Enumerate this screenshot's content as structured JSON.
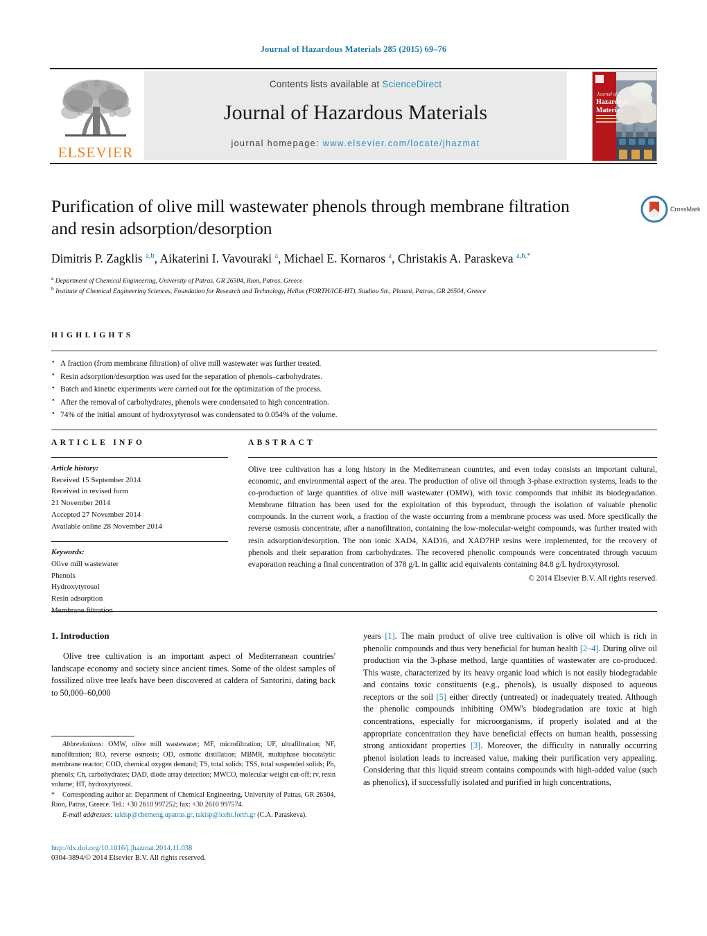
{
  "running_head": "Journal of Hazardous Materials 285 (2015) 69–76",
  "masthead": {
    "publisher_name": "ELSEVIER",
    "contents_prefix": "Contents lists available at",
    "contents_link": "ScienceDirect",
    "journal_title": "Journal of Hazardous Materials",
    "homepage_prefix": "journal homepage:",
    "homepage_url": "www.elsevier.com/locate/jhazmat",
    "cover_line1": "Journal of",
    "cover_line2": "Hazardous",
    "cover_line3": "Materials"
  },
  "article": {
    "title": "Purification of olive mill wastewater phenols through membrane filtration and resin adsorption/desorption",
    "authors_html": "Dimitris P. Zagklis <sup>a,b</sup>, Aikaterini I. Vavouraki <sup>a</sup>, Michael E. Kornaros <sup>a</sup>, Christakis A. Paraskeva <sup>a,b,</sup><sup>*</sup>",
    "affiliation_a": "Department of Chemical Engineering, University of Patras, GR 26504, Rion, Patras, Greece",
    "affiliation_b": "Institute of Chemical Engineering Sciences, Foundation for Research and Technology, Hellas (FORTH/ICE-HT), Stadiou Str., Platani, Patras, GR 26504, Greece",
    "crossmark_label": "CrossMark"
  },
  "highlights": {
    "heading": "HIGHLIGHTS",
    "items": [
      "A fraction (from membrane filtration) of olive mill wastewater was further treated.",
      "Resin adsorption/desorption was used for the separation of phenols–carbohydrates.",
      "Batch and kinetic experiments were carried out for the optimization of the process.",
      "After the removal of carbohydrates, phenols were condensated to high concentration.",
      "74% of the initial amount of hydroxytyrosol was condensated to 0.054% of the volume."
    ]
  },
  "article_info": {
    "heading": "ARTICLE INFO",
    "history_label": "Article history:",
    "history": [
      "Received 15 September 2014",
      "Received in revised form",
      "21 November 2014",
      "Accepted 27 November 2014",
      "Available online 28 November 2014"
    ],
    "keywords_label": "Keywords:",
    "keywords": [
      "Olive mill wastewater",
      "Phenols",
      "Hydroxytyrosol",
      "Resin adsorption",
      "Membrane filtration"
    ]
  },
  "abstract": {
    "heading": "ABSTRACT",
    "text": "Olive tree cultivation has a long history in the Mediterranean countries, and even today consists an important cultural, economic, and environmental aspect of the area. The production of olive oil through 3-phase extraction systems, leads to the co-production of large quantities of olive mill wastewater (OMW), with toxic compounds that inhibit its biodegradation. Membrane filtration has been used for the exploitation of this byproduct, through the isolation of valuable phenolic compounds. In the current work, a fraction of the waste occurring from a membrane process was used. More specifically the reverse osmosis concentrate, after a nanofiltration, containing the low-molecular-weight compounds, was further treated with resin adsorption/desorption. The non ionic XAD4, XAD16, and XAD7HP resins were implemented, for the recovery of phenols and their separation from carbohydrates. The recovered phenolic compounds were concentrated through vacuum evaporation reaching a final concentration of 378 g/L in gallic acid equivalents containing 84.8 g/L hydroxytyrosol.",
    "copyright": "© 2014 Elsevier B.V. All rights reserved."
  },
  "body": {
    "section_heading": "1.  Introduction",
    "left_paragraph": "Olive tree cultivation is an important aspect of Mediterranean countries' landscape economy and society since ancient times. Some of the oldest samples of fossilized olive tree leafs have been discovered at caldera of Santorini, dating back to 50,000–60,000",
    "right_paragraph_1": "years [1]. The main product of olive tree cultivation is olive oil which is rich in phenolic compounds and thus very beneficial for human health [2–4]. During olive oil production via the 3-phase method, large quantities of wastewater are co-produced. This waste, characterized by its heavy organic load which is not easily biodegradable and contains toxic constituents (e.g., phenols), is usually disposed to aqueous receptors or the soil [5] either directly (untreated) or inadequately treated. Although the phenolic compounds inhibiting OMW's biodegradation are toxic at high concentrations, especially for microorganisms, if properly isolated and at the appropriate concentration they have beneficial effects on human health, possessing strong antioxidant properties [3]. Moreover, the difficulty in naturally occurring phenol isolation leads to increased value, making their purification very appealing. Considering that this liquid stream contains compounds with high-added value (such as phenolics), if successfully isolated and purified in high concentrations,"
  },
  "footnotes": {
    "abbrev_label": "Abbreviations:",
    "abbrev_text": "OMW, olive mill wastewater; MF, microfiltration; UF, ultrafiltration; NF, nanofiltration; RO, reverse osmosis; OD, osmotic distillation; MBMR, multiphase biocatalytic membrane reactor; COD, chemical oxygen demand; TS, total solids; TSS, total suspended solids; Ph, phenols; Ch, carbohydrates; DAD, diode array detection; MWCO, molecular weight cut-off; rv, resin volume; HT, hydroxytyrosol.",
    "corresponding_marker": "*",
    "corresponding_text": "Corresponding author at: Department of Chemical Engineering, University of Patras, GR 26504, Rion, Patras, Greece. Tel.: +30 2610 997252; fax: +30 2610 997574.",
    "email_label": "E-mail addresses:",
    "email_1": "takisp@chemeng.upatras.gr",
    "email_2": "takisp@iceht.forth.gr",
    "email_person": "(C.A. Paraskeva)."
  },
  "footer": {
    "doi": "http://dx.doi.org/10.1016/j.jhazmat.2014.11.038",
    "issn_line": "0304-3894/© 2014 Elsevier B.V. All rights reserved."
  },
  "colors": {
    "link": "#1f7ba6",
    "elsevier_orange": "#f07c1b",
    "band_gray": "#eaeaea"
  }
}
